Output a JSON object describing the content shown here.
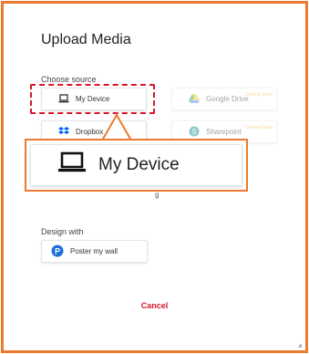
{
  "dialog": {
    "title": "Upload Media",
    "choose_source_label": "Choose source",
    "design_with_label": "Design with",
    "cancel_label": "Cancel"
  },
  "sources": [
    {
      "label": "My Device",
      "icon": "laptop-icon"
    },
    {
      "label": "Google Drive",
      "icon": "google-drive-icon",
      "badge": "Coming Soon"
    },
    {
      "label": "Dropbox",
      "icon": "dropbox-icon"
    },
    {
      "label": "Sharepoint",
      "icon": "sharepoint-icon",
      "badge": "Coming Soon"
    }
  ],
  "design_with": {
    "label": "Poster my wall",
    "icon": "postermywall-icon"
  },
  "zoom_callout": {
    "label": "My Device",
    "icon": "laptop-icon"
  },
  "colors": {
    "frame_orange": "#ec7a2e",
    "highlight_red": "#d8182a",
    "coming_soon": "#f2a21b"
  }
}
